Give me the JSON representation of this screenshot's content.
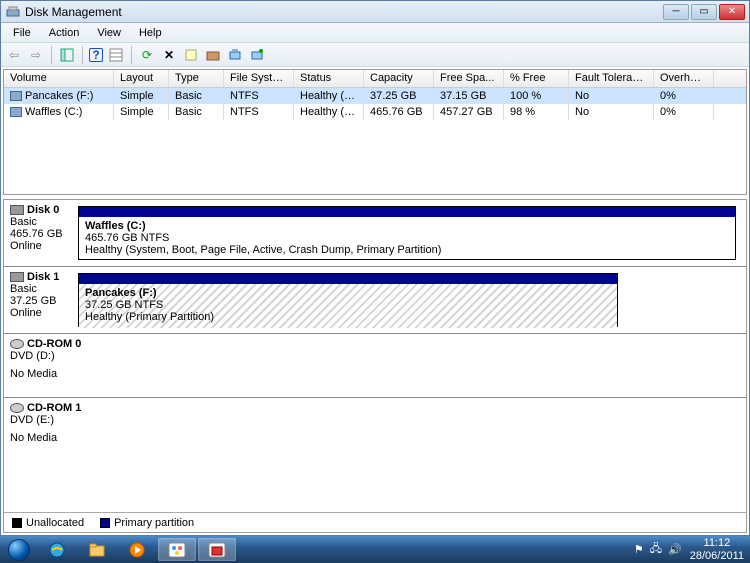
{
  "window": {
    "title": "Disk Management",
    "menu": {
      "file": "File",
      "action": "Action",
      "view": "View",
      "help": "Help"
    }
  },
  "volumeTable": {
    "headers": {
      "volume": "Volume",
      "layout": "Layout",
      "type": "Type",
      "fs": "File System",
      "status": "Status",
      "capacity": "Capacity",
      "free": "Free Spa...",
      "pct": "% Free",
      "ft": "Fault Tolerance",
      "oh": "Overhead"
    },
    "rows": [
      {
        "volume": "Pancakes (F:)",
        "layout": "Simple",
        "type": "Basic",
        "fs": "NTFS",
        "status": "Healthy (P...",
        "capacity": "37.25 GB",
        "free": "37.15 GB",
        "pct": "100 %",
        "ft": "No",
        "oh": "0%",
        "selected": true
      },
      {
        "volume": "Waffles (C:)",
        "layout": "Simple",
        "type": "Basic",
        "fs": "NTFS",
        "status": "Healthy (S...",
        "capacity": "465.76 GB",
        "free": "457.27 GB",
        "pct": "98 %",
        "ft": "No",
        "oh": "0%",
        "selected": false
      }
    ]
  },
  "disks": [
    {
      "name": "Disk 0",
      "type": "Basic",
      "size": "465.76 GB",
      "state": "Online",
      "partition": {
        "name": "Waffles  (C:)",
        "info": "465.76 GB NTFS",
        "status": "Healthy (System, Boot, Page File, Active, Crash Dump, Primary Partition)",
        "hatched": false,
        "widthpct": 88
      }
    },
    {
      "name": "Disk 1",
      "type": "Basic",
      "size": "37.25 GB",
      "state": "Online",
      "partition": {
        "name": "Pancakes  (F:)",
        "info": "37.25 GB NTFS",
        "status": "Healthy (Primary Partition)",
        "hatched": true,
        "widthpct": 82
      }
    }
  ],
  "cdroms": [
    {
      "name": "CD-ROM 0",
      "drive": "DVD (D:)",
      "state": "No Media"
    },
    {
      "name": "CD-ROM 1",
      "drive": "DVD (E:)",
      "state": "No Media"
    }
  ],
  "legend": {
    "unallocated": "Unallocated",
    "primary": "Primary partition"
  },
  "tray": {
    "time": "11:12",
    "date": "28/06/2011"
  }
}
